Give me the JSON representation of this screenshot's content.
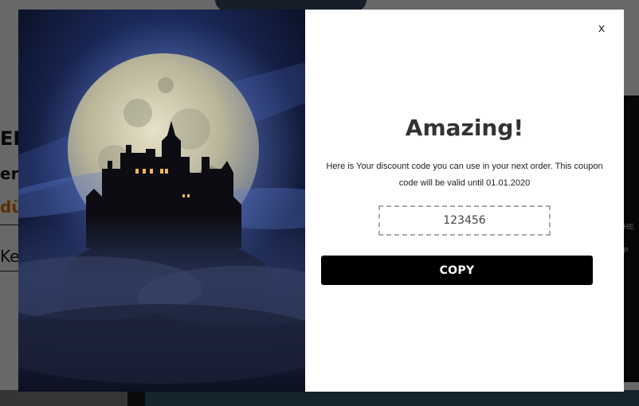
{
  "background": {
    "texts": [
      "EL",
      "ero",
      "dü",
      "Ke"
    ],
    "shirt_text": [
      "HE",
      "P"
    ]
  },
  "modal": {
    "close_label": "x",
    "title": "Amazing!",
    "message": "Here is Your discount code you can use in your next order. This coupon code will be valid until 01.01.2020",
    "code": "123456",
    "copy_label": "COPY",
    "image_icon": "castle-moon-image"
  },
  "colors": {
    "button_bg": "#000000",
    "button_text": "#ffffff",
    "modal_bg": "#ffffff",
    "overlay": "rgba(0,0,0,0.52)"
  }
}
